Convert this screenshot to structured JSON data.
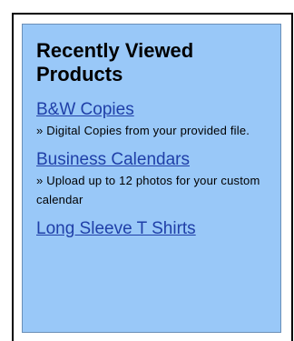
{
  "panel": {
    "title": "Recently Viewed Products"
  },
  "products": [
    {
      "name": "B&W Copies",
      "description": "» Digital Copies from your provided file."
    },
    {
      "name": "Business Calendars",
      "description": "» Upload up to 12 photos for your custom calendar"
    },
    {
      "name": "Long Sleeve T Shirts",
      "description": ""
    }
  ],
  "colors": {
    "panel_background": "#99c8f8",
    "link": "#1f3fa8",
    "frame_border": "#000000"
  }
}
